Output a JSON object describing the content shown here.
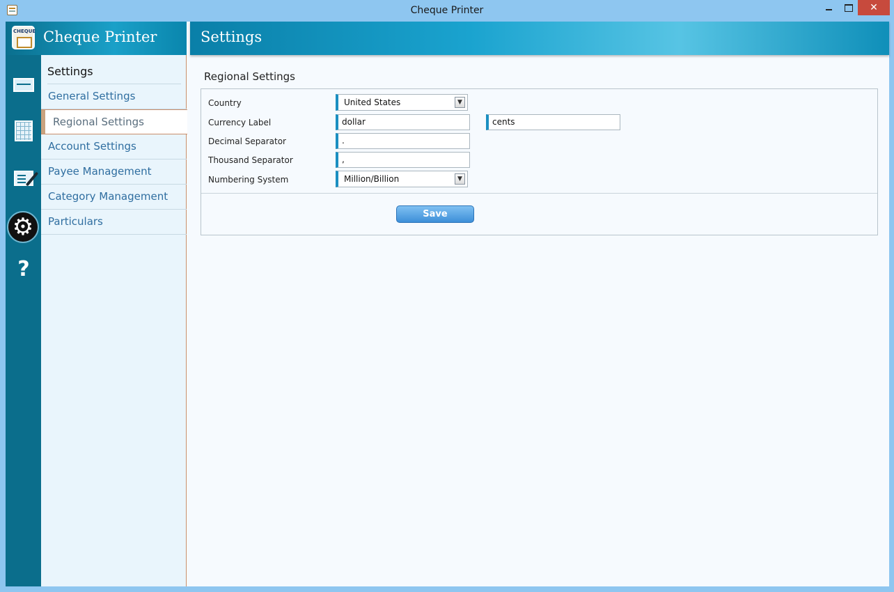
{
  "window": {
    "title": "Cheque Printer",
    "minimize_label": "",
    "maximize_label": "",
    "close_label": "✕"
  },
  "brand": {
    "logo_text": "CHEQUE",
    "app_name": "Cheque Printer"
  },
  "rail": {
    "icons": [
      "cheque-icon",
      "ledger-icon",
      "write-cheque-icon",
      "gear-icon",
      "help-icon"
    ],
    "gear_glyph": "⚙",
    "help_glyph": "?"
  },
  "subnav": {
    "heading": "Settings",
    "items": [
      {
        "label": "General Settings",
        "active": false
      },
      {
        "label": "Regional Settings",
        "active": true
      },
      {
        "label": "Account Settings",
        "active": false
      },
      {
        "label": "Payee Management",
        "active": false
      },
      {
        "label": "Category Management",
        "active": false
      },
      {
        "label": "Particulars",
        "active": false
      }
    ]
  },
  "main": {
    "title": "Settings",
    "section_title": "Regional Settings",
    "form": {
      "country_label": "Country",
      "country_value": "United States",
      "currency_label": "Currency Label",
      "currency_major": "dollar",
      "currency_minor": "cents",
      "decimal_label": "Decimal Separator",
      "decimal_value": ".",
      "thousand_label": "Thousand Separator",
      "thousand_value": ",",
      "numbering_label": "Numbering System",
      "numbering_value": "Million/Billion",
      "dropdown_glyph": "▼"
    },
    "save_label": "Save"
  },
  "colors": {
    "accent": "#1b8fc1",
    "rail": "#0b6e8c",
    "close": "#c74a3d"
  }
}
